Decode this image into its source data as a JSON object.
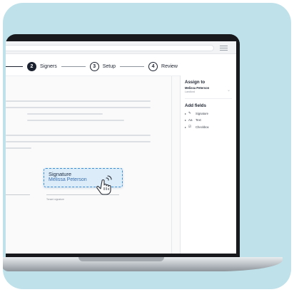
{
  "stepper": {
    "steps": [
      {
        "number": "2",
        "label": "Signers",
        "state": "current"
      },
      {
        "number": "3",
        "label": "Setup",
        "state": "upcoming"
      },
      {
        "number": "4",
        "label": "Review",
        "state": "upcoming"
      }
    ]
  },
  "document": {
    "signature_field": {
      "title": "Signature",
      "signer": "Melissa Peterson"
    },
    "tenant_caption": "Tenant signature"
  },
  "sidebar": {
    "assign_heading": "Assign to",
    "assignee_name": "Melissa Peterson",
    "assignee_role": "Landlord",
    "fields_heading": "Add fields",
    "fields": [
      {
        "icon": "signature-icon",
        "label": "Signature"
      },
      {
        "icon": "text-icon",
        "label": "Text"
      },
      {
        "icon": "checkbox-icon",
        "label": "Checkbox"
      }
    ]
  },
  "colors": {
    "background": "#bfe1ea",
    "accent": "#3d8fd6",
    "field_fill": "#dcecf8"
  }
}
